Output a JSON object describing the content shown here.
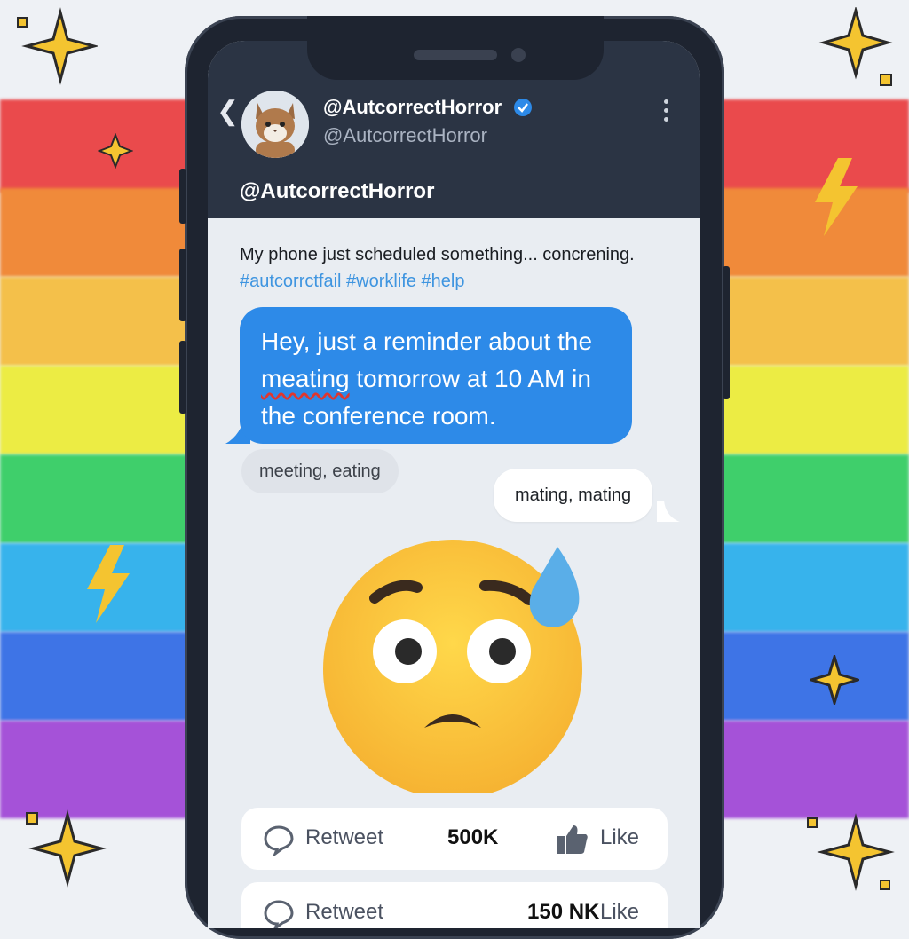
{
  "profile": {
    "display_handle": "@AutcorrectHorror",
    "sub_handle": "@AutcorrectHorror",
    "page_title": "@AutcorrectHorror"
  },
  "tweet": {
    "text": "My phone just scheduled something... concrening.",
    "hashtags": "#autcorrctfail #worklife #help"
  },
  "message": {
    "before": "Hey, just a reminder about the ",
    "typo": "meating",
    "after": " tomorrow at 10 AM in the conference room."
  },
  "suggestion": "meeting, eating",
  "reply": "mating, mating",
  "actions": {
    "retweet_label": "Retweet",
    "count": "500K",
    "like_label": "Like",
    "row2_retweet_label": "Retweet",
    "row2_count": "150 NK",
    "row2_like_label": "Like"
  },
  "colors": {
    "header_bg": "#2b3444",
    "bubble_blue": "#2d8ae8",
    "hashtag_blue": "#3f95e0",
    "typo_underline": "#e0362e"
  },
  "icons": [
    "back-chevron-icon",
    "verified-badge-icon",
    "more-kebab-icon",
    "comment-bubble-icon",
    "thumbs-up-icon",
    "worried-face-emoji",
    "sparkle-icon",
    "lightning-icon"
  ]
}
